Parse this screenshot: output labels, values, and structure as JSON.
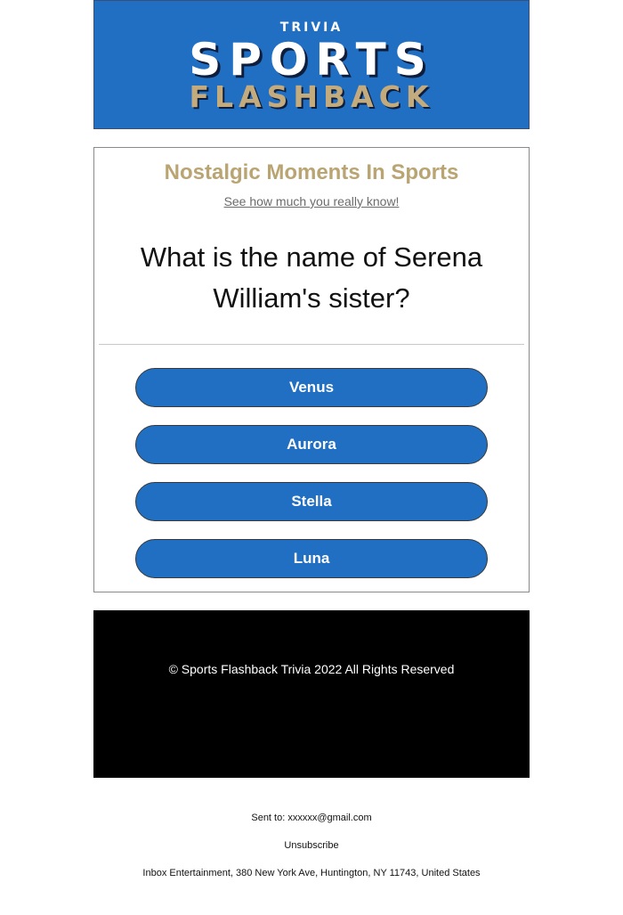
{
  "header": {
    "logo_trivia": "TRIVIA",
    "logo_sports": "SPORTS",
    "logo_flashback": "FLASHBACK"
  },
  "card": {
    "title": "Nostalgic Moments In Sports",
    "subtitle": "See how much you really know!",
    "question": "What is the name of Serena William's sister?",
    "answers": [
      "Venus",
      "Aurora",
      "Stella",
      "Luna"
    ]
  },
  "footer": {
    "copyright": "© Sports Flashback Trivia 2022 All Rights Reserved"
  },
  "meta": {
    "sent_to": "Sent to: xxxxxx@gmail.com",
    "unsubscribe": "Unsubscribe",
    "address": "Inbox Entertainment, 380 New York Ave, Huntington, NY 11743, United States"
  },
  "colors": {
    "brand_blue": "#206fc3",
    "gold": "#b9a472",
    "footer_bg": "#000000"
  }
}
